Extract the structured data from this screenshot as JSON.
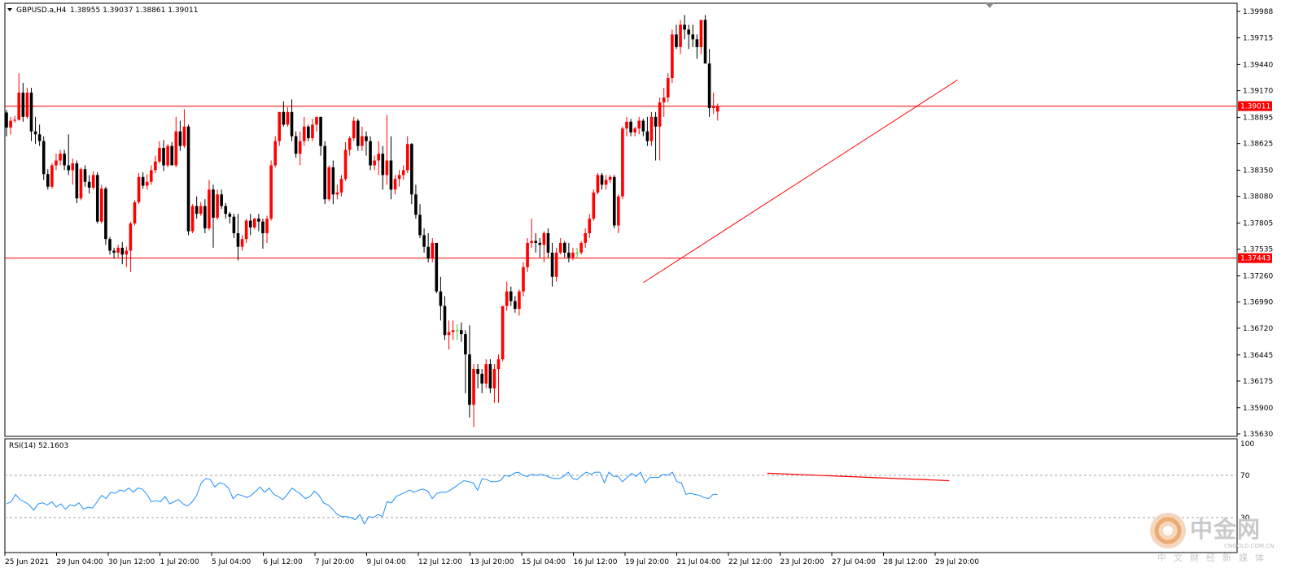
{
  "header": {
    "symbol_label": "GBPUSD.a,H4",
    "ohlc": "1.38955 1.39037 1.38861 1.39011"
  },
  "rsi": {
    "label": "RSI(14) 52.1603",
    "levels": {
      "top": "100",
      "upper": "70",
      "lower": "30"
    },
    "upper_value": 70,
    "lower_value": 30,
    "values": [
      43,
      45,
      52,
      47,
      45,
      42,
      37,
      43,
      44,
      42,
      45,
      40,
      43,
      38,
      42,
      41,
      44,
      38,
      40,
      39,
      45,
      51,
      48,
      54,
      53,
      56,
      55,
      58,
      54,
      58,
      57,
      52,
      45,
      46,
      45,
      50,
      43,
      45,
      47,
      43,
      41,
      45,
      51,
      63,
      67,
      66,
      59,
      63,
      62,
      58,
      48,
      52,
      51,
      49,
      51,
      55,
      59,
      54,
      58,
      52,
      50,
      47,
      52,
      58,
      55,
      52,
      48,
      50,
      55,
      51,
      44,
      42,
      38,
      33,
      31,
      31,
      30,
      28,
      33,
      24,
      31,
      30,
      33,
      31,
      45,
      44,
      50,
      52,
      54,
      56,
      54,
      56,
      57,
      55,
      48,
      53,
      54,
      54,
      56,
      59,
      62,
      65,
      64,
      63,
      56,
      67,
      66,
      64,
      64,
      65,
      70,
      69,
      72,
      73,
      70,
      69,
      71,
      70,
      71,
      70,
      68,
      67,
      67,
      69,
      73,
      67,
      66,
      70,
      73,
      71,
      73,
      73,
      63,
      73,
      69,
      69,
      64,
      68,
      72,
      69,
      73,
      63,
      68,
      68,
      68,
      71,
      70,
      73,
      64,
      63,
      52,
      53,
      52,
      51,
      49,
      48,
      52,
      52
    ]
  },
  "price_axis": {
    "min": 1.3563,
    "max": 1.39988,
    "ticks": [
      "1.39988",
      "1.39715",
      "1.39440",
      "1.39170",
      "1.38895",
      "1.38625",
      "1.38350",
      "1.38080",
      "1.37805",
      "1.37535",
      "1.37260",
      "1.36990",
      "1.36720",
      "1.36445",
      "1.36175",
      "1.35900",
      "1.35630"
    ],
    "tags": [
      {
        "label": "1.39011",
        "value": 1.39011
      },
      {
        "label": "1.37443",
        "value": 1.37443
      }
    ]
  },
  "time_axis": {
    "labels": [
      "25 Jun 2021",
      "29 Jun 04:00",
      "30 Jun 12:00",
      "1 Jul 20:00",
      "5 Jul 04:00",
      "6 Jul 12:00",
      "7 Jul 20:00",
      "9 Jul 04:00",
      "12 Jul 12:00",
      "13 Jul 20:00",
      "15 Jul 04:00",
      "16 Jul 12:00",
      "19 Jul 20:00",
      "21 Jul 04:00",
      "22 Jul 12:00",
      "23 Jul 20:00",
      "27 Jul 04:00",
      "28 Jul 12:00",
      "29 Jul 20:00"
    ]
  },
  "horizontal_lines": [
    1.39011,
    1.37443
  ],
  "trend_line": {
    "from": {
      "bar": 154,
      "price": 1.3719
    },
    "to": {
      "bar": 230,
      "price": 1.3928
    }
  },
  "rsi_trend_line": {
    "from": {
      "bar": 184,
      "value": 72
    },
    "to": {
      "bar": 228,
      "value": 65
    }
  },
  "colors": {
    "bull": "#ff0000",
    "bear": "#000000",
    "doji": "#32cd32",
    "grid": "#c0c0c0",
    "level_line": "#ff0000",
    "rsi_line": "#1e90ff",
    "axis_text": "#000000"
  },
  "watermark": {
    "name": "中金网",
    "url": "CNGOLD.COM.CN",
    "tagline": "中文财经新媒体"
  },
  "chart_data": {
    "type": "candlestick",
    "title": "GBPUSD.a,H4",
    "ylim": [
      1.3563,
      1.39988
    ],
    "candles": [
      [
        1.38945,
        1.3897,
        1.387,
        1.3879
      ],
      [
        1.3879,
        1.389,
        1.3872,
        1.3886
      ],
      [
        1.3886,
        1.3891,
        1.3884,
        1.3887
      ],
      [
        1.3887,
        1.3935,
        1.3886,
        1.3915
      ],
      [
        1.3915,
        1.3925,
        1.3885,
        1.389
      ],
      [
        1.389,
        1.392,
        1.3888,
        1.3915
      ],
      [
        1.3915,
        1.392,
        1.3865,
        1.3875
      ],
      [
        1.3875,
        1.389,
        1.3862,
        1.3872
      ],
      [
        1.3872,
        1.3882,
        1.386,
        1.3865
      ],
      [
        1.3865,
        1.387,
        1.3825,
        1.3831
      ],
      [
        1.3831,
        1.3836,
        1.3815,
        1.3818
      ],
      [
        1.3818,
        1.3842,
        1.3816,
        1.384
      ],
      [
        1.384,
        1.3852,
        1.3835,
        1.3845
      ],
      [
        1.3845,
        1.3856,
        1.384,
        1.3852
      ],
      [
        1.3852,
        1.3856,
        1.3835,
        1.384
      ],
      [
        1.384,
        1.3872,
        1.383,
        1.3835
      ],
      [
        1.3835,
        1.3847,
        1.382,
        1.3842
      ],
      [
        1.3842,
        1.3845,
        1.3801,
        1.3806
      ],
      [
        1.3806,
        1.3838,
        1.3804,
        1.3836
      ],
      [
        1.3836,
        1.384,
        1.3818,
        1.3823
      ],
      [
        1.3823,
        1.383,
        1.3811,
        1.3817
      ],
      [
        1.3817,
        1.3834,
        1.3815,
        1.383
      ],
      [
        1.383,
        1.3833,
        1.378,
        1.3782
      ],
      [
        1.3782,
        1.382,
        1.378,
        1.3816
      ],
      [
        1.3816,
        1.3818,
        1.3758,
        1.3764
      ],
      [
        1.3764,
        1.3766,
        1.3748,
        1.3752
      ],
      [
        1.3752,
        1.3755,
        1.3744,
        1.375
      ],
      [
        1.375,
        1.3758,
        1.3745,
        1.3755
      ],
      [
        1.3755,
        1.3761,
        1.3738,
        1.3748
      ],
      [
        1.3748,
        1.3756,
        1.3735,
        1.3752
      ],
      [
        1.3752,
        1.3782,
        1.373,
        1.378
      ],
      [
        1.378,
        1.3804,
        1.3778,
        1.3802
      ],
      [
        1.3802,
        1.3832,
        1.38,
        1.3828
      ],
      [
        1.3828,
        1.3833,
        1.3816,
        1.3819
      ],
      [
        1.3819,
        1.3831,
        1.3815,
        1.3823
      ],
      [
        1.3823,
        1.384,
        1.382,
        1.3835
      ],
      [
        1.3835,
        1.385,
        1.3832,
        1.3844
      ],
      [
        1.3844,
        1.3865,
        1.3842,
        1.3858
      ],
      [
        1.3858,
        1.3866,
        1.3834,
        1.384
      ],
      [
        1.384,
        1.3862,
        1.3838,
        1.386
      ],
      [
        1.386,
        1.3864,
        1.384,
        1.384
      ],
      [
        1.384,
        1.389,
        1.3838,
        1.3875
      ],
      [
        1.3875,
        1.3886,
        1.3855,
        1.386
      ],
      [
        1.386,
        1.3898,
        1.3858,
        1.388
      ],
      [
        1.388,
        1.3882,
        1.3768,
        1.3772
      ],
      [
        1.3772,
        1.38,
        1.377,
        1.3798
      ],
      [
        1.3798,
        1.3808,
        1.3785,
        1.379
      ],
      [
        1.379,
        1.3802,
        1.3788,
        1.3798
      ],
      [
        1.3798,
        1.3805,
        1.377,
        1.3775
      ],
      [
        1.3775,
        1.3825,
        1.3773,
        1.3815
      ],
      [
        1.3815,
        1.382,
        1.3755,
        1.3786
      ],
      [
        1.3786,
        1.3815,
        1.3784,
        1.381
      ],
      [
        1.381,
        1.3815,
        1.3795,
        1.3798
      ],
      [
        1.3798,
        1.3801,
        1.3785,
        1.379
      ],
      [
        1.379,
        1.3792,
        1.378,
        1.3787
      ],
      [
        1.3787,
        1.379,
        1.3765,
        1.377
      ],
      [
        1.377,
        1.379,
        1.3742,
        1.3756
      ],
      [
        1.3756,
        1.3768,
        1.3752,
        1.3764
      ],
      [
        1.3764,
        1.3785,
        1.376,
        1.3783
      ],
      [
        1.3783,
        1.379,
        1.3768,
        1.3776
      ],
      [
        1.3776,
        1.3786,
        1.3774,
        1.3785
      ],
      [
        1.3785,
        1.379,
        1.3772,
        1.3782
      ],
      [
        1.3782,
        1.3785,
        1.3754,
        1.377
      ],
      [
        1.377,
        1.3788,
        1.376,
        1.3785
      ],
      [
        1.3785,
        1.3845,
        1.3783,
        1.384
      ],
      [
        1.384,
        1.387,
        1.3838,
        1.3865
      ],
      [
        1.3865,
        1.3895,
        1.386,
        1.3895
      ],
      [
        1.3895,
        1.3906,
        1.388,
        1.3882
      ],
      [
        1.3882,
        1.39,
        1.388,
        1.3895
      ],
      [
        1.3895,
        1.3908,
        1.3865,
        1.387
      ],
      [
        1.387,
        1.3875,
        1.3848,
        1.3852
      ],
      [
        1.3852,
        1.3875,
        1.384,
        1.3865
      ],
      [
        1.3865,
        1.389,
        1.386,
        1.388
      ],
      [
        1.388,
        1.3882,
        1.3865,
        1.3868
      ],
      [
        1.3868,
        1.3888,
        1.3865,
        1.3882
      ],
      [
        1.3882,
        1.389,
        1.3875,
        1.389
      ],
      [
        1.389,
        1.389,
        1.385,
        1.386
      ],
      [
        1.386,
        1.3865,
        1.38,
        1.3805
      ],
      [
        1.3805,
        1.384,
        1.3803,
        1.3838
      ],
      [
        1.3838,
        1.3845,
        1.38,
        1.381
      ],
      [
        1.381,
        1.382,
        1.3805,
        1.3812
      ],
      [
        1.3812,
        1.383,
        1.3808,
        1.3826
      ],
      [
        1.3826,
        1.3864,
        1.3824,
        1.3856
      ],
      [
        1.3856,
        1.387,
        1.385,
        1.3868
      ],
      [
        1.3868,
        1.389,
        1.3865,
        1.3886
      ],
      [
        1.3886,
        1.3888,
        1.3855,
        1.386
      ],
      [
        1.386,
        1.388,
        1.3855,
        1.387
      ],
      [
        1.387,
        1.3875,
        1.385,
        1.3865
      ],
      [
        1.3865,
        1.387,
        1.3835,
        1.384
      ],
      [
        1.384,
        1.385,
        1.3835,
        1.3845
      ],
      [
        1.3845,
        1.3865,
        1.383,
        1.3852
      ],
      [
        1.3852,
        1.386,
        1.3815,
        1.383
      ],
      [
        1.383,
        1.3892,
        1.382,
        1.3845
      ],
      [
        1.3845,
        1.387,
        1.3805,
        1.3815
      ],
      [
        1.3815,
        1.383,
        1.381,
        1.3826
      ],
      [
        1.3826,
        1.3835,
        1.3818,
        1.383
      ],
      [
        1.383,
        1.384,
        1.3825,
        1.3835
      ],
      [
        1.3835,
        1.387,
        1.3832,
        1.3862
      ],
      [
        1.3862,
        1.3863,
        1.38,
        1.381
      ],
      [
        1.381,
        1.382,
        1.3785,
        1.3789
      ],
      [
        1.3789,
        1.38,
        1.3765,
        1.3768
      ],
      [
        1.3768,
        1.3775,
        1.375,
        1.3756
      ],
      [
        1.3756,
        1.377,
        1.374,
        1.3744
      ],
      [
        1.3744,
        1.3765,
        1.374,
        1.376
      ],
      [
        1.376,
        1.376,
        1.3708,
        1.371
      ],
      [
        1.371,
        1.3725,
        1.368,
        1.3695
      ],
      [
        1.3695,
        1.3705,
        1.366,
        1.3665
      ],
      [
        1.3665,
        1.368,
        1.365,
        1.3668
      ],
      [
        1.3668,
        1.368,
        1.366,
        1.367
      ],
      [
        1.367,
        1.3676,
        1.366,
        1.367
      ],
      [
        1.367,
        1.3678,
        1.3658,
        1.3666
      ],
      [
        1.3666,
        1.367,
        1.3605,
        1.3645
      ],
      [
        1.3645,
        1.3675,
        1.358,
        1.3593
      ],
      [
        1.3593,
        1.3635,
        1.357,
        1.363
      ],
      [
        1.363,
        1.3635,
        1.361,
        1.3625
      ],
      [
        1.3625,
        1.363,
        1.3605,
        1.3615
      ],
      [
        1.3615,
        1.364,
        1.361,
        1.3635
      ],
      [
        1.3635,
        1.364,
        1.3605,
        1.361
      ],
      [
        1.361,
        1.3635,
        1.3595,
        1.363
      ],
      [
        1.363,
        1.3645,
        1.3595,
        1.364
      ],
      [
        1.364,
        1.3695,
        1.3638,
        1.3695
      ],
      [
        1.3695,
        1.372,
        1.369,
        1.371
      ],
      [
        1.371,
        1.3715,
        1.3695,
        1.37
      ],
      [
        1.37,
        1.3705,
        1.3688,
        1.3692
      ],
      [
        1.3692,
        1.3712,
        1.3685,
        1.371
      ],
      [
        1.371,
        1.374,
        1.3705,
        1.3735
      ],
      [
        1.3735,
        1.3765,
        1.373,
        1.376
      ],
      [
        1.376,
        1.3785,
        1.3755,
        1.3762
      ],
      [
        1.3762,
        1.377,
        1.375,
        1.376
      ],
      [
        1.376,
        1.3765,
        1.3745,
        1.3758
      ],
      [
        1.3758,
        1.3772,
        1.374,
        1.377
      ],
      [
        1.377,
        1.3775,
        1.3745,
        1.375
      ],
      [
        1.375,
        1.376,
        1.3715,
        1.3725
      ],
      [
        1.3725,
        1.3755,
        1.372,
        1.375
      ],
      [
        1.375,
        1.3765,
        1.3748,
        1.376
      ],
      [
        1.376,
        1.3762,
        1.3745,
        1.375
      ],
      [
        1.375,
        1.376,
        1.374,
        1.3745
      ],
      [
        1.3745,
        1.3755,
        1.3742,
        1.375
      ],
      [
        1.375,
        1.3755,
        1.3745,
        1.375
      ],
      [
        1.375,
        1.3762,
        1.3748,
        1.376
      ],
      [
        1.376,
        1.3775,
        1.3755,
        1.377
      ],
      [
        1.377,
        1.379,
        1.3765,
        1.3785
      ],
      [
        1.3785,
        1.3815,
        1.3783,
        1.3812
      ],
      [
        1.3812,
        1.3832,
        1.381,
        1.383
      ],
      [
        1.383,
        1.3832,
        1.3815,
        1.382
      ],
      [
        1.382,
        1.383,
        1.3815,
        1.3825
      ],
      [
        1.3825,
        1.383,
        1.3822,
        1.3828
      ],
      [
        1.3828,
        1.383,
        1.3775,
        1.3778
      ],
      [
        1.3778,
        1.381,
        1.377,
        1.3808
      ],
      [
        1.3808,
        1.388,
        1.3805,
        1.3878
      ],
      [
        1.3878,
        1.389,
        1.387,
        1.3885
      ],
      [
        1.3885,
        1.3888,
        1.387,
        1.3874
      ],
      [
        1.3874,
        1.388,
        1.387,
        1.3878
      ],
      [
        1.3878,
        1.389,
        1.3872,
        1.3886
      ],
      [
        1.3886,
        1.3888,
        1.387,
        1.3875
      ],
      [
        1.3875,
        1.389,
        1.386,
        1.3865
      ],
      [
        1.3865,
        1.3895,
        1.386,
        1.389
      ],
      [
        1.389,
        1.3895,
        1.3845,
        1.388
      ],
      [
        1.388,
        1.391,
        1.3845,
        1.3905
      ],
      [
        1.3905,
        1.392,
        1.389,
        1.391
      ],
      [
        1.391,
        1.3935,
        1.3905,
        1.393
      ],
      [
        1.393,
        1.398,
        1.3925,
        1.3975
      ],
      [
        1.3975,
        1.3985,
        1.396,
        1.3962
      ],
      [
        1.3962,
        1.399,
        1.3955,
        1.3985
      ],
      [
        1.3985,
        1.3995,
        1.397,
        1.398
      ],
      [
        1.398,
        1.3985,
        1.396,
        1.3975
      ],
      [
        1.3975,
        1.3985,
        1.3962,
        1.397
      ],
      [
        1.397,
        1.3975,
        1.395,
        1.3962
      ],
      [
        1.3962,
        1.399,
        1.3955,
        1.399
      ],
      [
        1.399,
        1.3995,
        1.395,
        1.3945
      ],
      [
        1.3945,
        1.396,
        1.389,
        1.3899
      ],
      [
        1.3899,
        1.3915,
        1.3893,
        1.3901
      ],
      [
        1.38955,
        1.39037,
        1.38861,
        1.39011
      ]
    ]
  }
}
